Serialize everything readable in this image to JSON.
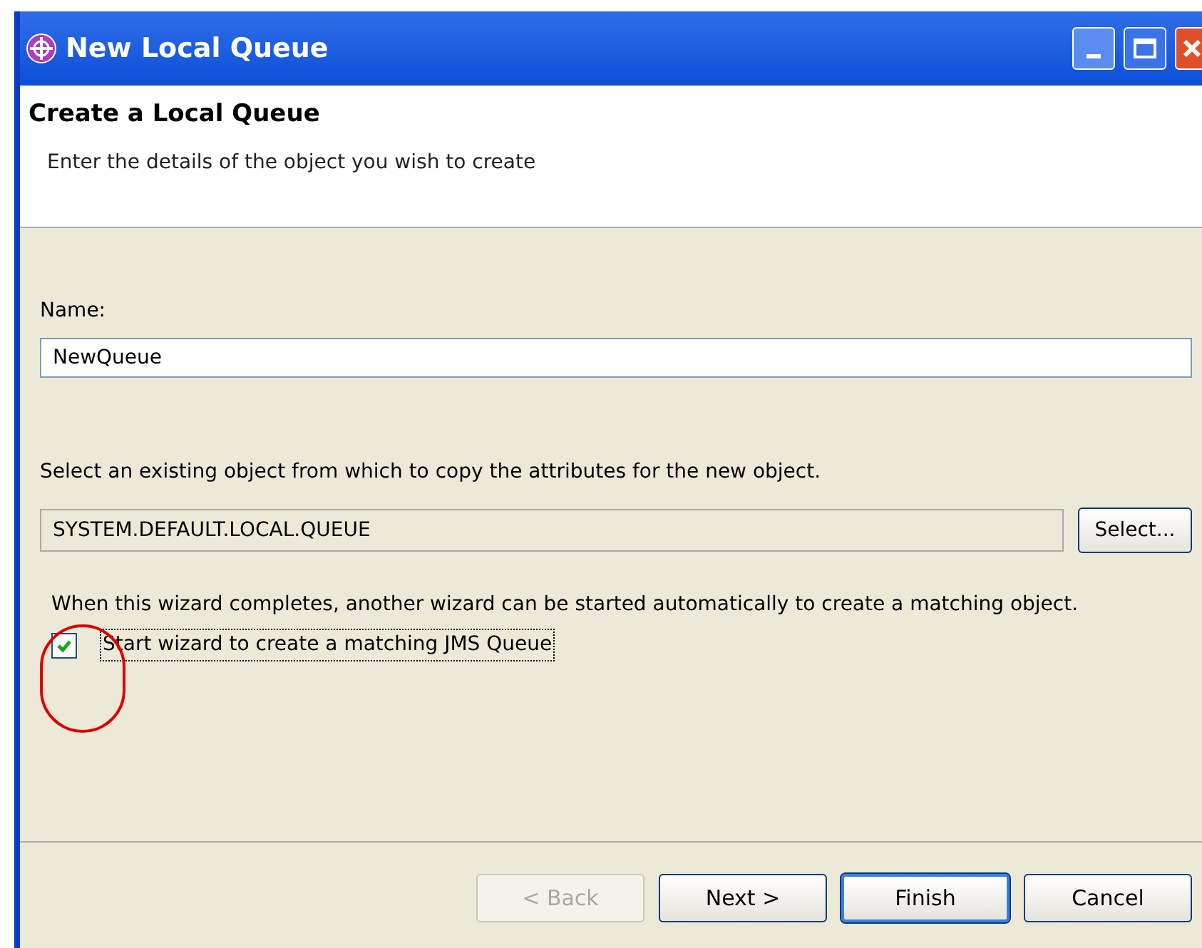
{
  "window": {
    "title": "New Local Queue"
  },
  "header": {
    "title": "Create a Local Queue",
    "description": "Enter the details of the object you wish to create"
  },
  "name_field": {
    "label": "Name:",
    "value": "NewQueue"
  },
  "copy_from": {
    "label": "Select an existing object from which to copy the attributes for the new object.",
    "value": "SYSTEM.DEFAULT.LOCAL.QUEUE",
    "button": "Select..."
  },
  "follow_up": {
    "text": "When this wizard completes, another wizard can be started automatically to create a matching object.",
    "checkbox": {
      "label": "Start wizard to create a matching JMS Queue",
      "checked": true
    }
  },
  "buttons": [
    {
      "label": "< Back",
      "disabled": true,
      "default": false
    },
    {
      "label": "Next >",
      "disabled": false,
      "default": false
    },
    {
      "label": "Finish",
      "disabled": false,
      "default": true
    },
    {
      "label": "Cancel",
      "disabled": false,
      "default": false
    }
  ]
}
